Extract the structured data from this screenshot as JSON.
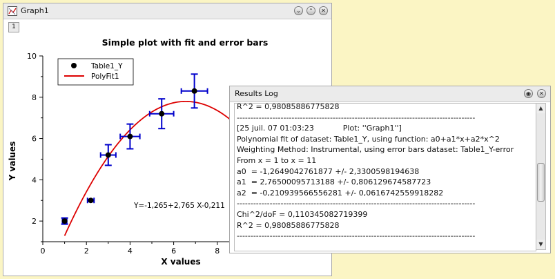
{
  "graph_window": {
    "title": "Graph1",
    "layer_tab": "1",
    "buttons": {
      "minimize": "⌄",
      "maximize": "⌃",
      "close": "✕"
    }
  },
  "chart_data": {
    "type": "scatter",
    "title": "Simple plot with fit and error bars",
    "xlabel": "X values",
    "ylabel": "Y values",
    "xlim": [
      0,
      10
    ],
    "ylim": [
      1,
      10
    ],
    "x_ticks": [
      0,
      2,
      4,
      6,
      8
    ],
    "y_ticks": [
      2,
      4,
      6,
      8,
      10
    ],
    "grid": false,
    "legend_position": "top-left",
    "series": [
      {
        "name": "Table1_Y",
        "kind": "points",
        "color": "#000000",
        "error_color": "#0000cc",
        "points": [
          {
            "x": 1.0,
            "y": 2.0,
            "xerr": 0.1,
            "yerr": 0.15
          },
          {
            "x": 2.2,
            "y": 3.0,
            "xerr": 0.15,
            "yerr": 0.05
          },
          {
            "x": 3.0,
            "y": 5.2,
            "xerr": 0.35,
            "yerr": 0.5
          },
          {
            "x": 4.0,
            "y": 6.1,
            "xerr": 0.45,
            "yerr": 0.6
          },
          {
            "x": 5.45,
            "y": 7.2,
            "xerr": 0.55,
            "yerr": 0.72
          },
          {
            "x": 6.95,
            "y": 8.3,
            "xerr": 0.6,
            "yerr": 0.82
          }
        ]
      },
      {
        "name": "PolyFit1",
        "kind": "fit",
        "color": "#dd0000",
        "coefficients": [
          -1.2649042761877,
          2.76500095713188,
          -0.210939566556281
        ]
      }
    ],
    "annotation": "Y=-1,265+2,765 X-0,211"
  },
  "results_log": {
    "title": "Results Log",
    "lines": [
      "R^2 = 0,98085886775828",
      "---------------------------------------------------------------------------------------",
      "[25 juil. 07 01:03:23            Plot: ''Graph1'']",
      "Polynomial fit of dataset: Table1_Y, using function: a0+a1*x+a2*x^2",
      "Weighting Method: Instrumental, using error bars dataset: Table1_Y-error",
      "From x = 1 to x = 11",
      "a0  = -1,2649042761877 +/- 2,3300598194638",
      "a1  = 2,76500095713188 +/- 0,806129674587723",
      "a2  = -0,210939566556281 +/- 0,0616742559918282",
      "---------------------------------------------------------------------------------------",
      "Chi^2/doF = 0,110345082719399",
      "R^2 = 0,98085886775828",
      "---------------------------------------------------------------------------------------"
    ],
    "buttons": {
      "float": "◉",
      "close": "✕"
    }
  }
}
